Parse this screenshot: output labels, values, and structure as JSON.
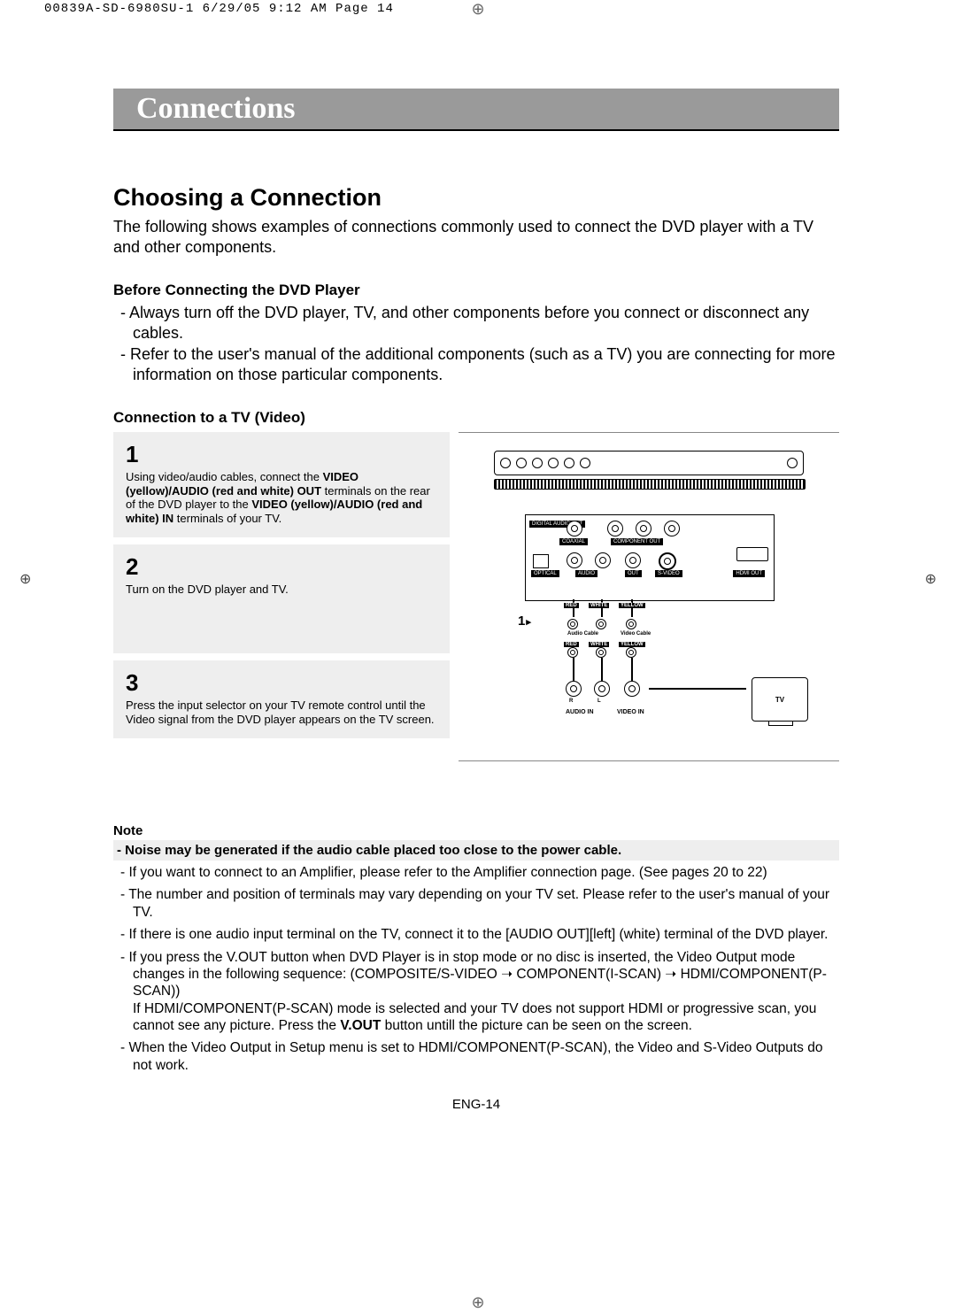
{
  "print_header": "00839A-SD-6980SU-1  6/29/05  9:12 AM  Page 14",
  "title": "Connections",
  "h2": "Choosing a Connection",
  "intro": "The following shows examples of connections commonly used to connect the DVD player with a TV and other components.",
  "before_hd": "Before Connecting the DVD Player",
  "before": [
    "Always turn off the DVD player, TV, and other components before you connect or disconnect any cables.",
    "Refer to the user's manual of the additional components (such as a TV) you are connecting for more information on those particular components."
  ],
  "conn_hd": "Connection to a TV (Video)",
  "steps": [
    {
      "n": "1",
      "html": "Using video/audio cables, connect the <b>VIDEO (yellow)/AUDIO (red and white) OUT</b> terminals on the rear of the DVD player to the <b>VIDEO (yellow)/AUDIO (red and white) IN</b> terminals of your TV."
    },
    {
      "n": "2",
      "html": "Turn on the DVD player and TV."
    },
    {
      "n": "3",
      "html": "Press the input selector on your TV remote control until the Video signal from the DVD player appears on the TV screen."
    }
  ],
  "note_hd": "Note",
  "note_bar": "-  Noise may be generated if the audio cable placed too close to the power cable.",
  "notes": [
    "If you want to connect to an Amplifier, please refer to the Amplifier connection page. (See pages 20 to 22)",
    "The number and position of terminals may vary depending on your TV set. Please refer to the user's manual of your TV.",
    "If there is one audio input terminal on the TV, connect it to the [AUDIO OUT][left] (white) terminal of the DVD player.",
    "If you press the V.OUT button when DVD Player is in stop mode or no disc is inserted, the Video Output mode changes in the following sequence: (COMPOSITE/S-VIDEO ➝ COMPONENT(I-SCAN) ➝ HDMI/COMPONENT(P-SCAN))\nIf HDMI/COMPONENT(P-SCAN) mode is selected and your TV does not support HDMI or progressive scan, you cannot see any picture. Press the <b>V.OUT</b> button untill the picture can be seen on the screen.",
    "When the Video Output in Setup menu is set to HDMI/COMPONENT(P-SCAN), the Video and S-Video Outputs do not work."
  ],
  "page_num": "ENG-14",
  "diagram": {
    "panel_labels": {
      "dao": "DIGITAL AUDIO OUT",
      "coax": "COAXIAL",
      "comp": "COMPONENT OUT",
      "opt": "OPTICAL",
      "aud": "AUDIO",
      "out": "OUT",
      "sv": "S-VIDEO",
      "hdmi": "HDMI OUT"
    },
    "colors": {
      "red": "RED",
      "white": "WHITE",
      "yellow": "YELLOW"
    },
    "cables": {
      "audio": "Audio Cable",
      "video": "Video Cable"
    },
    "tv": "TV",
    "tvjacks": {
      "ain": "AUDIO IN",
      "vin": "VIDEO IN",
      "r": "R",
      "l": "L"
    },
    "step": "1"
  }
}
